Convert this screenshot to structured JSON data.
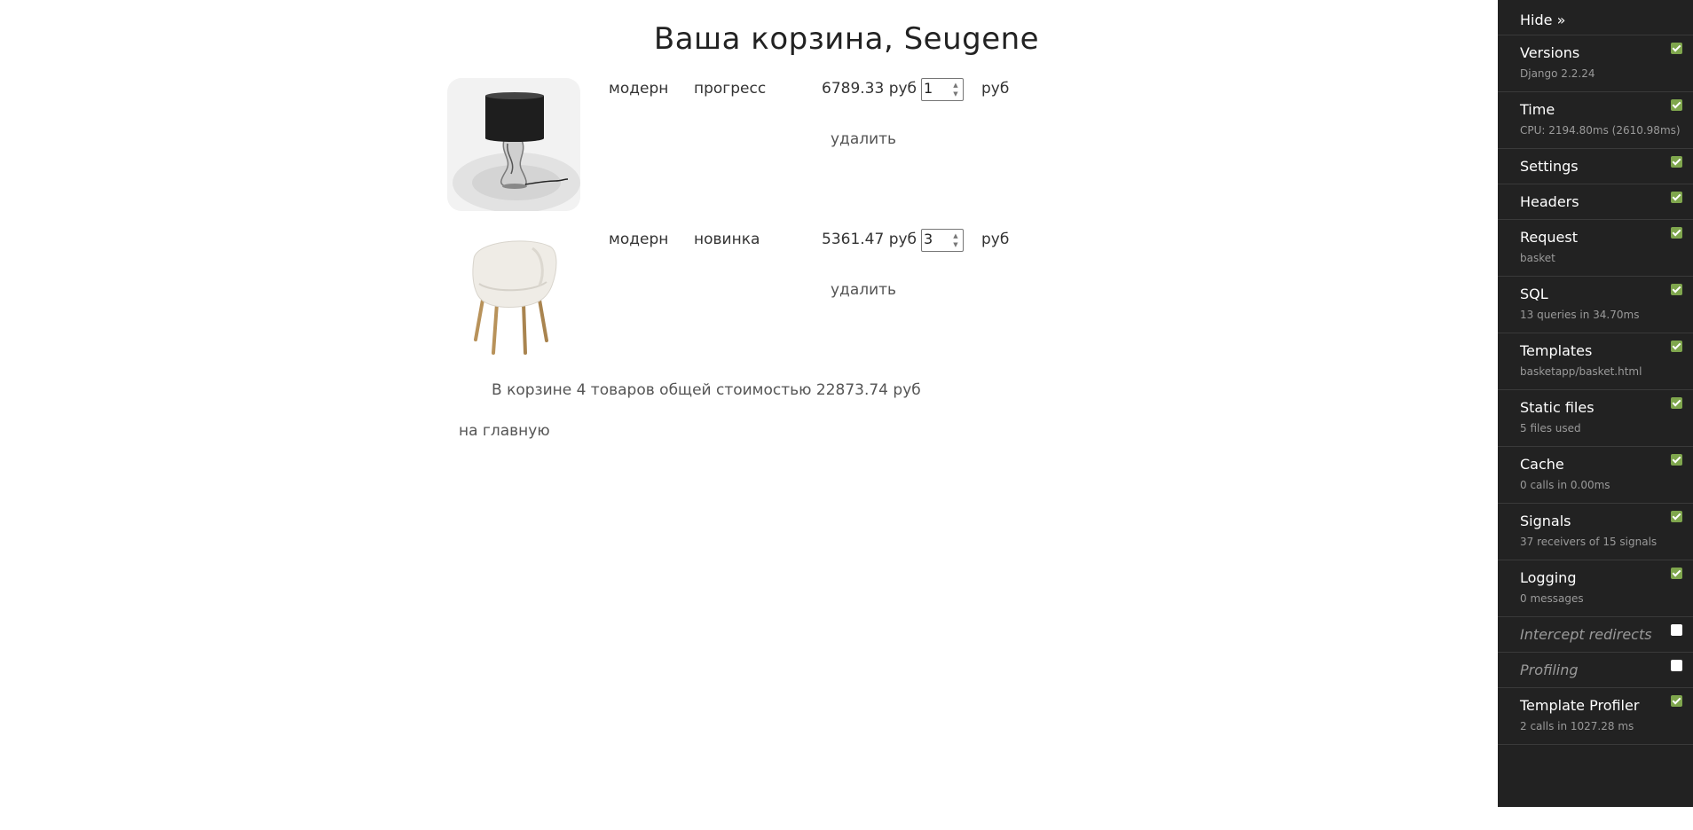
{
  "page": {
    "title": "Ваша корзина, Seugene"
  },
  "basket": {
    "items": [
      {
        "style": "модерн",
        "category": "прогресс",
        "price": "6789.33 руб",
        "quantity": "1",
        "currency": "руб",
        "delete_label": "удалить",
        "image": "table-lamp-image"
      },
      {
        "style": "модерн",
        "category": "новинка",
        "price": "5361.47 руб",
        "quantity": "3",
        "currency": "руб",
        "delete_label": "удалить",
        "image": "chair-image"
      }
    ],
    "total_text": "В корзине 4 товаров общей стоимостью 22873.74 руб",
    "home_link": "на главную"
  },
  "debug_toolbar": {
    "hide_label": "Hide »",
    "colors": {
      "background": "#222222",
      "check_on": "#7fa64d"
    },
    "panels": [
      {
        "title": "Versions",
        "subtitle": "Django 2.2.24",
        "enabled": true
      },
      {
        "title": "Time",
        "subtitle": "CPU: 2194.80ms (2610.98ms)",
        "enabled": true
      },
      {
        "title": "Settings",
        "subtitle": "",
        "enabled": true
      },
      {
        "title": "Headers",
        "subtitle": "",
        "enabled": true
      },
      {
        "title": "Request",
        "subtitle": "basket",
        "enabled": true
      },
      {
        "title": "SQL",
        "subtitle": "13 queries in 34.70ms",
        "enabled": true
      },
      {
        "title": "Templates",
        "subtitle": "basketapp/basket.html",
        "enabled": true
      },
      {
        "title": "Static files",
        "subtitle": "5 files used",
        "enabled": true
      },
      {
        "title": "Cache",
        "subtitle": "0 calls in 0.00ms",
        "enabled": true
      },
      {
        "title": "Signals",
        "subtitle": "37 receivers of 15 signals",
        "enabled": true
      },
      {
        "title": "Logging",
        "subtitle": "0 messages",
        "enabled": true
      },
      {
        "title": "Intercept redirects",
        "subtitle": "",
        "enabled": false
      },
      {
        "title": "Profiling",
        "subtitle": "",
        "enabled": false
      },
      {
        "title": "Template Profiler",
        "subtitle": "2 calls in 1027.28 ms",
        "enabled": true
      }
    ]
  }
}
